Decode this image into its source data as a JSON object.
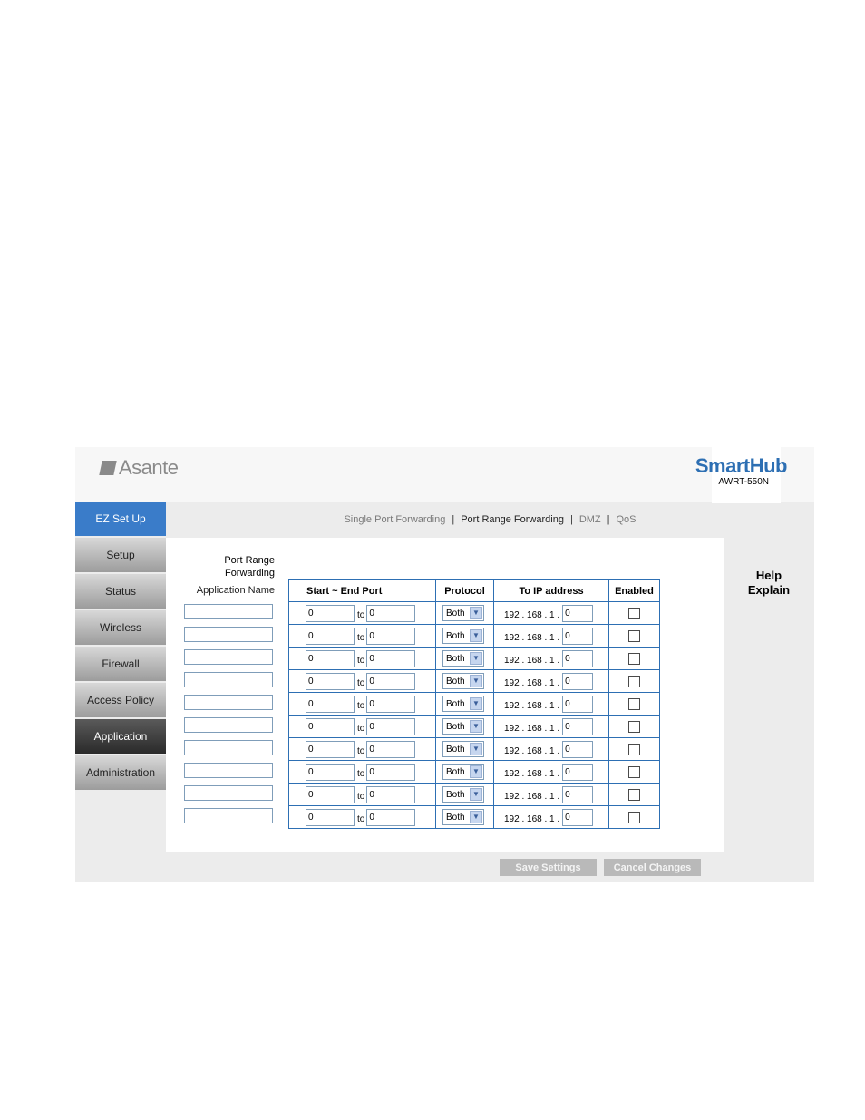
{
  "header": {
    "logo": "Asante",
    "brand": "SmartHub",
    "model": "AWRT-550N"
  },
  "nav": [
    "EZ Set Up",
    "Setup",
    "Status",
    "Wireless",
    "Firewall",
    "Access Policy",
    "Application",
    "Administration"
  ],
  "subnav": {
    "items": [
      "Single Port Forwarding",
      "Port Range Forwarding",
      "DMZ",
      "QoS"
    ],
    "separator": "|"
  },
  "section_title": [
    "Port Range",
    "Forwarding"
  ],
  "app_name_header": "Application Name",
  "table": {
    "headers": [
      "Start ~ End Port",
      "Protocol",
      "To IP address",
      "Enabled"
    ],
    "to_label": "to",
    "ip_prefix": "192 . 168 . 1 .",
    "rows": [
      {
        "name": "",
        "start": "0",
        "end": "0",
        "protocol": "Both",
        "ip": "0",
        "enabled": false
      },
      {
        "name": "",
        "start": "0",
        "end": "0",
        "protocol": "Both",
        "ip": "0",
        "enabled": false
      },
      {
        "name": "",
        "start": "0",
        "end": "0",
        "protocol": "Both",
        "ip": "0",
        "enabled": false
      },
      {
        "name": "",
        "start": "0",
        "end": "0",
        "protocol": "Both",
        "ip": "0",
        "enabled": false
      },
      {
        "name": "",
        "start": "0",
        "end": "0",
        "protocol": "Both",
        "ip": "0",
        "enabled": false
      },
      {
        "name": "",
        "start": "0",
        "end": "0",
        "protocol": "Both",
        "ip": "0",
        "enabled": false
      },
      {
        "name": "",
        "start": "0",
        "end": "0",
        "protocol": "Both",
        "ip": "0",
        "enabled": false
      },
      {
        "name": "",
        "start": "0",
        "end": "0",
        "protocol": "Both",
        "ip": "0",
        "enabled": false
      },
      {
        "name": "",
        "start": "0",
        "end": "0",
        "protocol": "Both",
        "ip": "0",
        "enabled": false
      },
      {
        "name": "",
        "start": "0",
        "end": "0",
        "protocol": "Both",
        "ip": "0",
        "enabled": false
      }
    ]
  },
  "help": [
    "Help",
    "Explain"
  ],
  "buttons": {
    "save": "Save Settings",
    "cancel": "Cancel Changes"
  },
  "colors": {
    "accent": "#2d6fb3",
    "ez_setup": "#3a7cc9",
    "active_nav": "#3a3a3a"
  }
}
